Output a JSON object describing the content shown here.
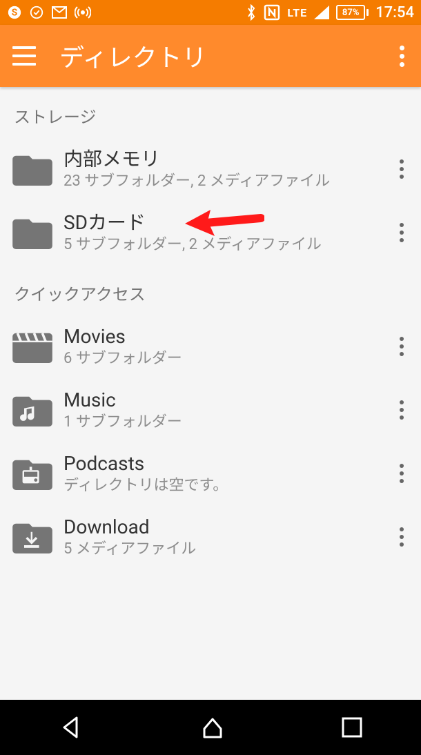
{
  "status": {
    "lte_label": "LTE",
    "battery_pct": "87%",
    "time": "17:54"
  },
  "appbar": {
    "title": "ディレクトリ"
  },
  "sections": {
    "storage_header": "ストレージ",
    "quick_header": "クイックアクセス"
  },
  "storage": [
    {
      "title": "内部メモリ",
      "subtitle": "23 サブフォルダー, 2 メディアファイル"
    },
    {
      "title": "SDカード",
      "subtitle": "5 サブフォルダー, 2 メディアファイル"
    }
  ],
  "quick": [
    {
      "title": "Movies",
      "subtitle": "6 サブフォルダー"
    },
    {
      "title": "Music",
      "subtitle": "1 サブフォルダー"
    },
    {
      "title": "Podcasts",
      "subtitle": "ディレクトリは空です。"
    },
    {
      "title": "Download",
      "subtitle": "5 メディアファイル"
    }
  ]
}
